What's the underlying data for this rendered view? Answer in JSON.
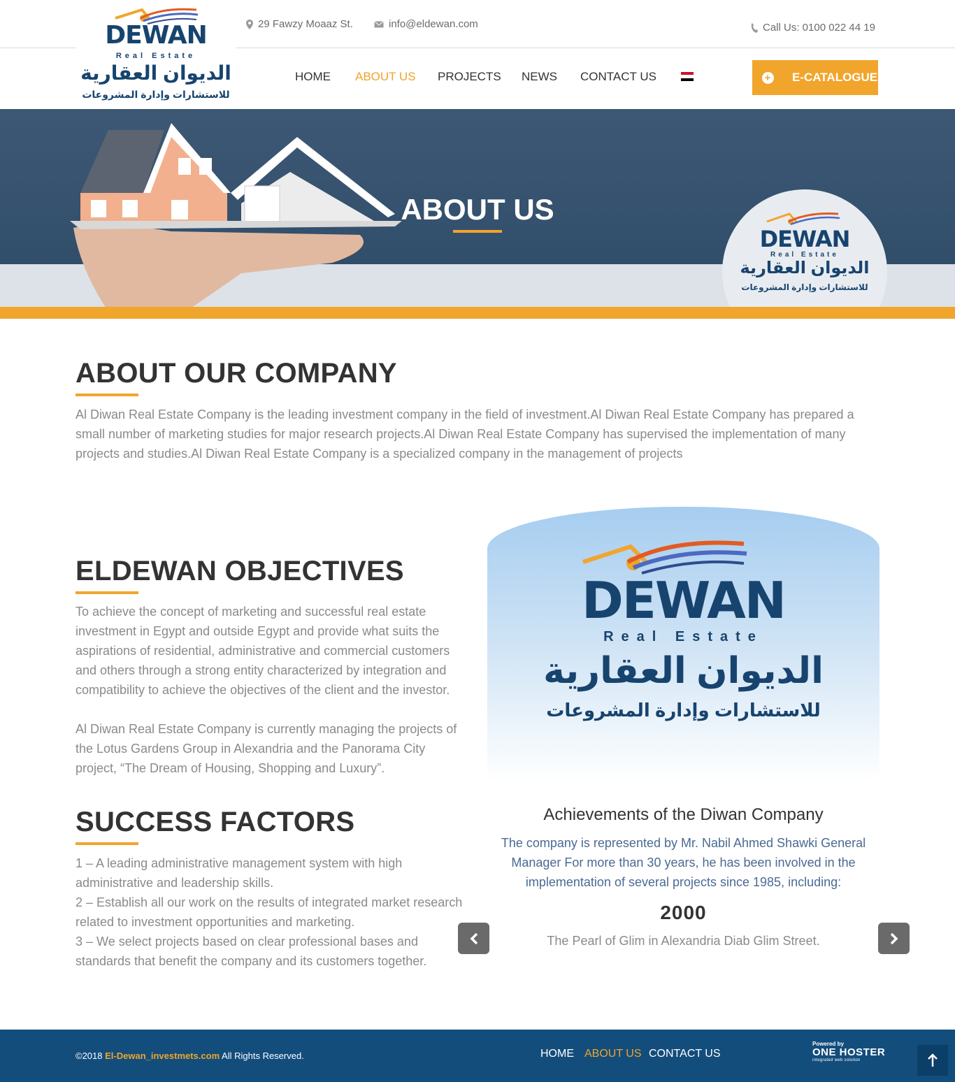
{
  "topbar": {
    "address": "29 Fawzy Moaaz St.",
    "email": "info@eldewan.com",
    "phone": "Call Us: 0100 022 44 19"
  },
  "logo": {
    "brand": "DEWAN",
    "subtitle": "Real Estate",
    "arabic_name": "الديوان العقارية",
    "arabic_tagline": "للاستشارات وإدارة المشروعات"
  },
  "nav": {
    "items": [
      {
        "label": "HOME",
        "active": false
      },
      {
        "label": "ABOUT US",
        "active": true
      },
      {
        "label": "PROJECTS",
        "active": false
      },
      {
        "label": "NEWS",
        "active": false
      },
      {
        "label": "CONTACT US",
        "active": false
      }
    ],
    "cta": "E-CATALOGUE"
  },
  "hero": {
    "title": "ABOUT US"
  },
  "about": {
    "heading": "ABOUT OUR COMPANY",
    "text": "Al Diwan Real Estate Company is the leading investment company in the field of investment.Al Diwan Real Estate Company has prepared a small number of marketing studies for major research projects.Al Diwan Real Estate Company has supervised the implementation of many projects and studies.Al Diwan Real Estate Company is a specialized company in the management of projects"
  },
  "objectives": {
    "heading": "ELDEWAN OBJECTIVES",
    "text": "To achieve the concept of marketing and successful real estate investment in Egypt and outside Egypt and provide what suits the aspirations of residential, administrative and commercial customers and others through a strong entity characterized by integration and compatibility to achieve the objectives of the client and the investor.",
    "text2": "Al Diwan Real Estate Company is currently managing the projects of the Lotus Gardens Group in Alexandria and the Panorama City project, “The Dream of Housing, Shopping and Luxury”."
  },
  "success": {
    "heading": "SUCCESS FACTORS",
    "items": [
      "1 – A leading administrative management system with high administrative and leadership skills.",
      "2 – Establish all our work on the results of integrated market research related to investment opportunities and marketing.",
      "3 – We select projects based on clear professional bases and standards that benefit the company and its customers together."
    ]
  },
  "achievements": {
    "title": "Achievements of the Diwan Company",
    "text": "The company is represented by Mr. Nabil Ahmed Shawki General Manager For more than 30 years, he has been involved in the implementation of several projects since 1985, including:",
    "year": "2000",
    "desc": "The Pearl of Glim in Alexandria Diab Glim Street."
  },
  "footer": {
    "copy_prefix": "©2018",
    "copy_site": "El-Dewan_investmets.com",
    "copy_suffix": "All Rights Reserved.",
    "nav": [
      {
        "label": "HOME",
        "active": false
      },
      {
        "label": "ABOUT US",
        "active": true
      },
      {
        "label": "CONTACT US",
        "active": false
      }
    ],
    "powered_by": "Powered by",
    "powered_brand": "ONE HOSTER",
    "powered_tag": "integrated web solution"
  },
  "colors": {
    "accent": "#f0a52d",
    "brand_blue": "#17446e",
    "footer_bg": "#134d7c"
  }
}
